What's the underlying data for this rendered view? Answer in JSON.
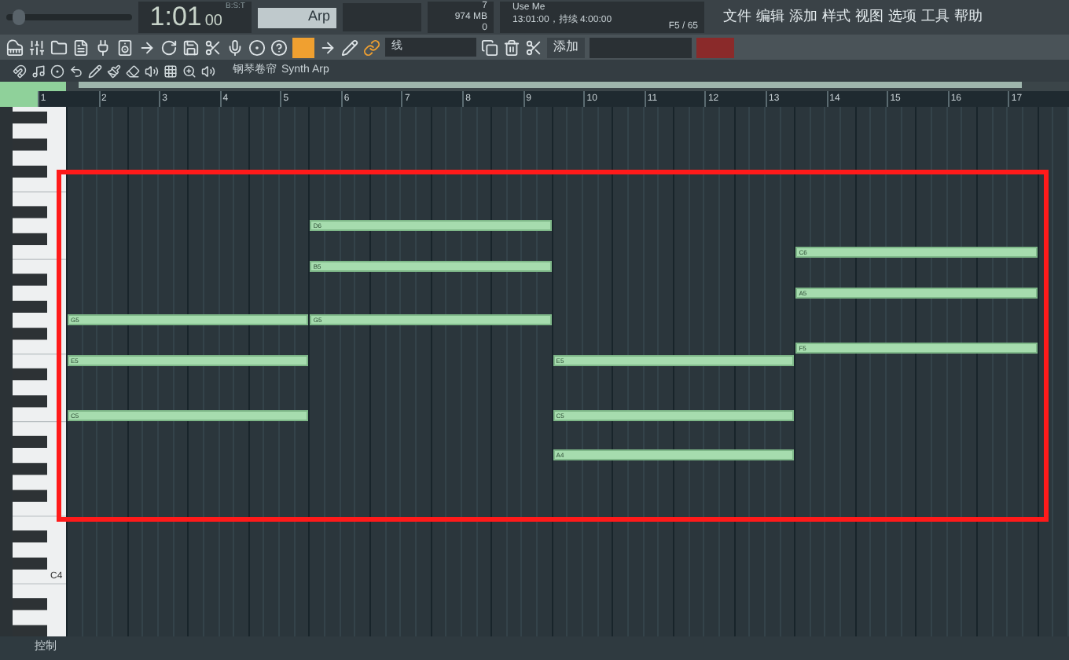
{
  "transport": {
    "time": "1:01",
    "time_small": "00",
    "time_units": "B:S:T",
    "pattern": "Arp"
  },
  "master_volume": {
    "level": 0.05
  },
  "status": {
    "cpu": "7",
    "memory": "974 MB",
    "polyphony": "0",
    "hint_title": "Use Me",
    "hint_detail": "13:01:00，持续 4:00:00",
    "position": "F5 / 65"
  },
  "menu": [
    "文件",
    "编辑",
    "添加",
    "样式",
    "视图",
    "选项",
    "工具",
    "帮助"
  ],
  "toolbar": {
    "tool_selected": true,
    "snap": "线",
    "add_button": "添加",
    "record_on": true
  },
  "breadcrumb": [
    "钢琴卷帘",
    "Synth Arp"
  ],
  "ruler": [
    "1",
    "2",
    "3",
    "4",
    "5",
    "6",
    "7",
    "8",
    "9",
    "10",
    "11",
    "12",
    "13",
    "14",
    "15",
    "16",
    "17"
  ],
  "key_label": "C4",
  "chords": [
    {
      "notes": [
        {
          "label": "G5"
        },
        {
          "label": "E5"
        },
        {
          "label": "C5"
        }
      ]
    },
    {
      "notes": [
        {
          "label": "D6"
        },
        {
          "label": "B5"
        },
        {
          "label": "G5"
        }
      ]
    },
    {
      "notes": [
        {
          "label": "E5"
        },
        {
          "label": "C5"
        },
        {
          "label": "A4"
        }
      ]
    },
    {
      "notes": [
        {
          "label": "C6"
        },
        {
          "label": "A5"
        },
        {
          "label": "F5"
        }
      ]
    }
  ],
  "footer": "控制"
}
